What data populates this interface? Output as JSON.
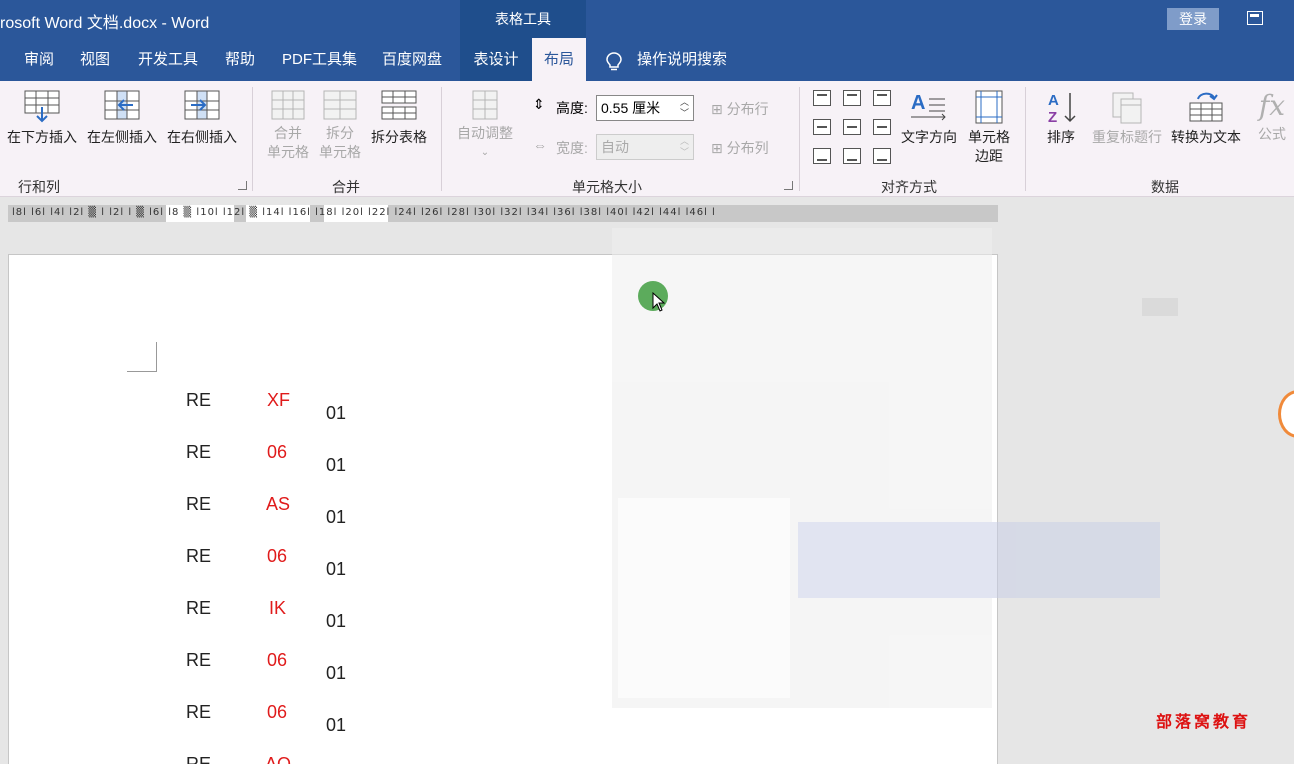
{
  "titlebar": {
    "doc_title": "rosoft Word 文档.docx  -  Word",
    "context_tab": "表格工具",
    "login": "登录"
  },
  "tabs": [
    "审阅",
    "视图",
    "开发工具",
    "帮助",
    "PDF工具集",
    "百度网盘",
    "表设计",
    "布局"
  ],
  "active_tab": "布局",
  "search_label": "操作说明搜索",
  "ribbon": {
    "rows_cols": {
      "insert_below": "在下方插入",
      "insert_left": "在左侧插入",
      "insert_right": "在右侧插入",
      "group": "行和列"
    },
    "merge": {
      "merge_cells_1": "合并",
      "merge_cells_2": "单元格",
      "split_cells_1": "拆分",
      "split_cells_2": "单元格",
      "split_table": "拆分表格",
      "group": "合并"
    },
    "cell_size": {
      "autofit": "自动调整",
      "height_label": "高度:",
      "height_value": "0.55 厘米",
      "width_label": "宽度:",
      "width_value": "自动",
      "dist_rows": "分布行",
      "dist_cols": "分布列",
      "group": "单元格大小"
    },
    "alignment": {
      "text_dir": "文字方向",
      "cell_margin_1": "单元格",
      "cell_margin_2": "边距",
      "group": "对齐方式"
    },
    "data": {
      "sort": "排序",
      "repeat_header": "重复标题行",
      "convert_text": "转换为文本",
      "formula": "公式",
      "group": "数据"
    }
  },
  "ruler_text": "l8l l6l l4l l2l ▒ l  l2l  l ▒ l6l l8 ▒ l10l l12l ▒ l14l l16l l18l l20l l22l l24l l26l l28l l30l l32l l34l l36l l38l l40l l42l l44l l46l l",
  "table_rows": [
    {
      "c1": "RE",
      "c2": "XF",
      "c3": "01"
    },
    {
      "c1": "RE",
      "c2": "06",
      "c3": "01"
    },
    {
      "c1": "RE",
      "c2": "AS",
      "c3": "01"
    },
    {
      "c1": "RE",
      "c2": "06",
      "c3": "01"
    },
    {
      "c1": "RE",
      "c2": "IK",
      "c3": "01"
    },
    {
      "c1": "RE",
      "c2": "06",
      "c3": "01"
    },
    {
      "c1": "RE",
      "c2": "06",
      "c3": "01"
    },
    {
      "c1": "RE",
      "c2": "AQ",
      "c3": ""
    }
  ],
  "watermark": "部落窝教育",
  "colors": {
    "title_blue": "#2b579a",
    "ribbon_bg": "#f7f2f7",
    "red_text": "#e01b1b"
  }
}
